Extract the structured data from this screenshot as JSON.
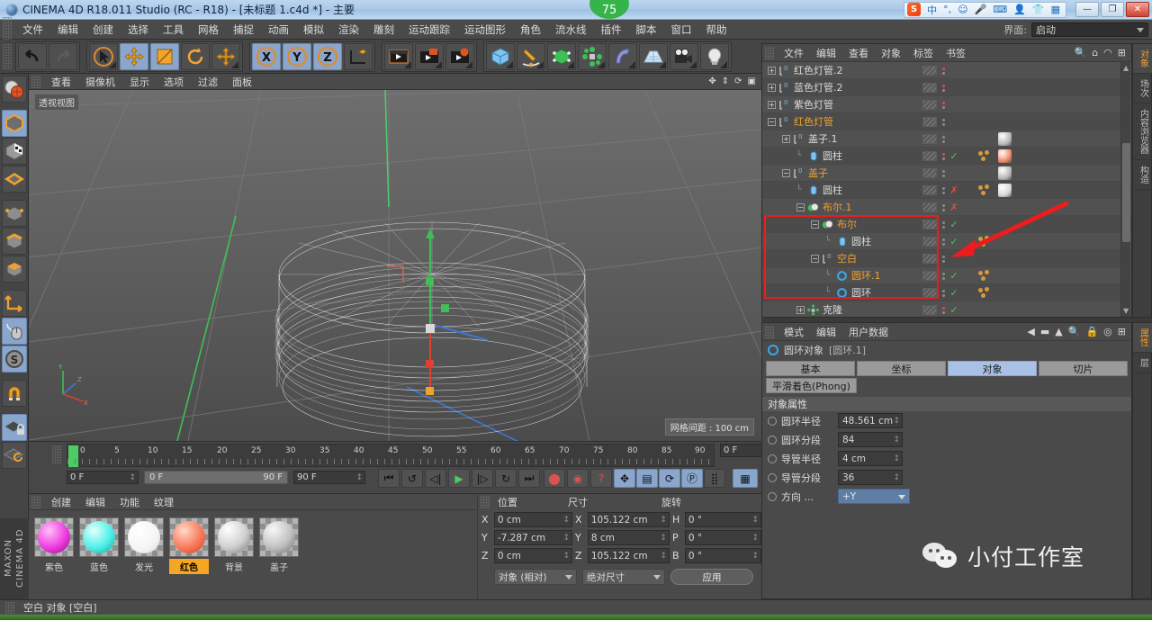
{
  "window": {
    "title": "CINEMA 4D R18.011 Studio (RC - R18) - [未标题 1.c4d *] - 主要",
    "minimize": "—",
    "maximize": "❐",
    "close": "✕",
    "badge": "75",
    "ime": {
      "logo": "S",
      "lang": "中",
      "punct": "°,",
      "face": "☺",
      "mic": "🎤",
      "kbd": "⌨",
      "user": "👤",
      "skin": "👕",
      "apps": "▦"
    }
  },
  "menu": {
    "items": [
      "文件",
      "编辑",
      "创建",
      "选择",
      "工具",
      "网格",
      "捕捉",
      "动画",
      "模拟",
      "渲染",
      "雕刻",
      "运动跟踪",
      "运动图形",
      "角色",
      "流水线",
      "插件",
      "脚本",
      "窗口",
      "帮助"
    ],
    "layout_label": "界面:",
    "layout_value": "启动"
  },
  "toolbar": {
    "undo": "undo-icon",
    "redo": "redo-icon",
    "select": "select-arrow-icon",
    "move": "move-icon",
    "scale": "scale-icon",
    "rotate": "rotate-icon",
    "move2": "move-axis-icon",
    "x": "X",
    "y": "Y",
    "z": "Z",
    "world": "world-coord-icon",
    "render_view": "render-view-icon",
    "render_region": "render-region-icon",
    "render_settings": "render-settings-icon",
    "primitive": "cube-icon",
    "spline": "pen-spline-icon",
    "generator": "generator-icon",
    "mograph": "mograph-icon",
    "deformer": "bend-deformer-icon",
    "floor": "floor-environment-icon",
    "camera": "camera-icon",
    "light": "light-icon"
  },
  "leftbar": {
    "items": [
      {
        "name": "texture-mode-icon",
        "sel": false
      },
      {
        "name": "model-mode-icon",
        "sel": true
      },
      {
        "name": "texture-axis-icon",
        "sel": false
      },
      {
        "name": "polygon-grid-icon",
        "sel": false
      },
      {
        "name": "point-mode-icon",
        "sel": false
      },
      {
        "name": "edge-mode-icon",
        "sel": false
      },
      {
        "name": "polygon-mode-icon",
        "sel": false
      },
      {
        "name": "axis-mode-icon",
        "sel": false
      },
      {
        "name": "viewport-solo-icon",
        "sel": true
      },
      {
        "name": "s-snap-icon",
        "sel": true
      },
      {
        "name": "magnet-icon",
        "sel": false
      },
      {
        "name": "lock-grid-icon",
        "sel": true
      },
      {
        "name": "workplane-icon",
        "sel": false
      }
    ],
    "brand": "MAXON CINEMA 4D"
  },
  "viewport": {
    "menu": [
      "查看",
      "摄像机",
      "显示",
      "选项",
      "过滤",
      "面板"
    ],
    "label": "透视视图",
    "grid_note": "网格间距 : 100 cm",
    "axis_x": "X",
    "axis_y": "Y",
    "axis_z": "Z"
  },
  "timeline": {
    "ticks": [
      "0",
      "5",
      "10",
      "15",
      "20",
      "25",
      "30",
      "35",
      "40",
      "45",
      "50",
      "55",
      "60",
      "65",
      "70",
      "75",
      "80",
      "85",
      "90"
    ],
    "current_frame_field": "0 F",
    "start_field": "0 F",
    "range_start": "0 F",
    "range_end": "90 F",
    "end_field": "90 F",
    "buttons": [
      "goto-start",
      "step-back-key",
      "step-back",
      "play",
      "step-forward",
      "step-forward-key",
      "goto-end"
    ],
    "record_buttons": [
      "record-keyframe",
      "autokey",
      "keyframe-selection"
    ],
    "track_buttons": [
      "position-track",
      "scale-track",
      "rotation-track",
      "parameter-track",
      "point-level-anim",
      "dope-sheet"
    ]
  },
  "materials": {
    "menu": [
      "创建",
      "编辑",
      "功能",
      "纹理"
    ],
    "items": [
      {
        "name": "紫色",
        "color": "#f03ce0",
        "selected": false
      },
      {
        "name": "蓝色",
        "color": "#4ef0e8",
        "selected": false
      },
      {
        "name": "发光",
        "color": "#ffffff",
        "selected": false
      },
      {
        "name": "红色",
        "color": "#f97a5a",
        "selected": true
      },
      {
        "name": "背景",
        "color": "#d6d6d6",
        "selected": false
      },
      {
        "name": "盖子",
        "color": "#c9c9c9",
        "selected": false
      }
    ]
  },
  "coordinates": {
    "headers": [
      "位置",
      "尺寸",
      "旋转"
    ],
    "rows": [
      {
        "l1": "X",
        "v1": "0 cm",
        "l2": "X",
        "v2": "105.122 cm",
        "l3": "H",
        "v3": "0 °"
      },
      {
        "l1": "Y",
        "v1": "-7.287 cm",
        "l2": "Y",
        "v2": "8 cm",
        "l3": "P",
        "v3": "0 °"
      },
      {
        "l1": "Z",
        "v1": "0 cm",
        "l2": "Z",
        "v2": "105.122 cm",
        "l3": "B",
        "v3": "0 °"
      }
    ],
    "mode_drop": "对象 (相对)",
    "size_drop": "绝对尺寸",
    "apply": "应用"
  },
  "object_manager": {
    "menu": [
      "文件",
      "编辑",
      "查看",
      "对象",
      "标签",
      "书签"
    ],
    "icons": [
      "search-icon",
      "home-icon",
      "eye-icon",
      "expand-icon"
    ],
    "rows": [
      {
        "indent": 0,
        "expander": "+",
        "icon": "null-object-icon",
        "name": "红色灯管.2",
        "orange": false,
        "dotred": true,
        "check": "",
        "tags": false,
        "mat": ""
      },
      {
        "indent": 0,
        "expander": "+",
        "icon": "null-object-icon",
        "name": "蓝色灯管.2",
        "orange": false,
        "dotred": true,
        "check": "",
        "tags": false,
        "mat": ""
      },
      {
        "indent": 0,
        "expander": "+",
        "icon": "null-object-icon",
        "name": "紫色灯管",
        "orange": false,
        "dotred": true,
        "check": "",
        "tags": false,
        "mat": ""
      },
      {
        "indent": 0,
        "expander": "−",
        "icon": "null-object-icon",
        "name": "红色灯管",
        "orange": true,
        "dotred": false,
        "check": "",
        "tags": false,
        "mat": ""
      },
      {
        "indent": 1,
        "expander": "+",
        "icon": "null-object-icon",
        "name": "盖子.1",
        "orange": false,
        "dotred": false,
        "check": "",
        "tags": false,
        "mat": "#b9b9b9"
      },
      {
        "indent": 2,
        "expander": "",
        "icon": "cylinder-icon",
        "name": "圆柱",
        "orange": false,
        "dotred": true,
        "check": "✓",
        "tags": true,
        "mat": "#f08a6a"
      },
      {
        "indent": 1,
        "expander": "−",
        "icon": "null-object-icon",
        "name": "盖子",
        "orange": true,
        "dotred": false,
        "check": "",
        "tags": false,
        "mat": "#b9b9b9"
      },
      {
        "indent": 2,
        "expander": "",
        "icon": "cylinder-icon",
        "name": "圆柱",
        "orange": false,
        "dotred": false,
        "check": "✗",
        "tags": true,
        "mat": "#d8d8d8"
      },
      {
        "indent": 2,
        "expander": "−",
        "icon": "boole-icon",
        "name": "布尔.1",
        "orange": true,
        "dotred": false,
        "check": "✗",
        "tags": false,
        "mat": ""
      },
      {
        "indent": 3,
        "expander": "−",
        "icon": "boole-icon",
        "name": "布尔",
        "orange": true,
        "dotred": false,
        "check": "✓",
        "tags": false,
        "mat": ""
      },
      {
        "indent": 4,
        "expander": "",
        "icon": "cylinder-icon",
        "name": "圆柱",
        "orange": false,
        "dotred": false,
        "check": "✓",
        "tags": true,
        "mat": ""
      },
      {
        "indent": 3,
        "expander": "−",
        "icon": "null-object-icon",
        "name": "空白",
        "orange": true,
        "dotred": false,
        "check": "",
        "tags": false,
        "mat": ""
      },
      {
        "indent": 4,
        "expander": "",
        "icon": "torus-icon",
        "name": "圆环.1",
        "orange": true,
        "dotred": false,
        "check": "✓",
        "tags": true,
        "mat": ""
      },
      {
        "indent": 4,
        "expander": "",
        "icon": "torus-icon",
        "name": "圆环",
        "orange": false,
        "dotred": false,
        "check": "✓",
        "tags": true,
        "mat": ""
      },
      {
        "indent": 2,
        "expander": "+",
        "icon": "cloner-icon",
        "name": "克隆",
        "orange": false,
        "dotred": true,
        "check": "✓",
        "tags": false,
        "mat": ""
      }
    ],
    "side_tabs": [
      {
        "label": "对象",
        "selected": true
      },
      {
        "label": "场次",
        "selected": false
      },
      {
        "label": "内容浏览器",
        "selected": false
      },
      {
        "label": "构造",
        "selected": false
      }
    ]
  },
  "attributes": {
    "menu": [
      "模式",
      "编辑",
      "用户数据"
    ],
    "icons": [
      "back-arrow-icon",
      "forward-arrow-icon",
      "up-arrow-icon",
      "search-icon",
      "lock-icon",
      "target-icon",
      "expand-icon"
    ],
    "object_title": "圆环对象",
    "object_name": "[圆环.1]",
    "tabs": [
      {
        "label": "基本",
        "selected": false
      },
      {
        "label": "坐标",
        "selected": false
      },
      {
        "label": "对象",
        "selected": true
      },
      {
        "label": "切片",
        "selected": false
      }
    ],
    "tab2": "平滑着色(Phong)",
    "section": "对象属性",
    "properties": [
      {
        "label": "圆环半径",
        "value": "48.561 cm",
        "type": "field"
      },
      {
        "label": "圆环分段",
        "value": "84",
        "type": "field"
      },
      {
        "label": "导管半径",
        "value": "4 cm",
        "type": "field"
      },
      {
        "label": "导管分段",
        "value": "36",
        "type": "field"
      },
      {
        "label": "方向 ...",
        "value": "+Y",
        "type": "dropdown"
      }
    ],
    "side_tabs": [
      {
        "label": "属性",
        "selected": true
      },
      {
        "label": "层",
        "selected": false
      }
    ]
  },
  "statusbar": {
    "text": "空白 对象 [空白]"
  },
  "watermark": {
    "text": "小付工作室"
  },
  "colors": {
    "accent_orange": "#f0a030",
    "annotation_red": "#ee1c1c",
    "selected_blue": "#a8c1e4",
    "green_check": "#4ec94e"
  }
}
